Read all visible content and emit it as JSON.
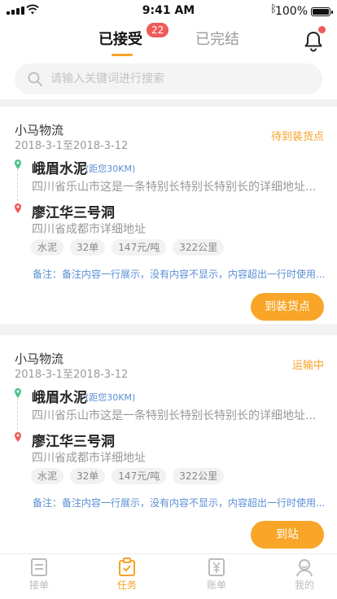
{
  "status_bar": {
    "time": "9:41 AM",
    "battery": "100%"
  },
  "header": {
    "tab_accepted": "已接受",
    "badge_count": "22",
    "tab_done": "已完结"
  },
  "search": {
    "placeholder": "请输入关键词进行搜索"
  },
  "cards": [
    {
      "company": "小马物流",
      "date": "2018-3-1至2018-3-12",
      "status": "待到装货点",
      "from_name": "峨眉水泥",
      "distance": "(距您30KM)",
      "from_addr": "四川省乐山市这是一条特别长特别长特别长的详细地址...",
      "to_name": "廖江华三号洞",
      "to_addr": "四川省成都市详细地址",
      "tags": [
        "水泥",
        "32单",
        "147元/吨",
        "322公里"
      ],
      "remark": "备注：备注内容一行展示，没有内容不显示，内容超出一行时使用...",
      "action": "到装货点"
    },
    {
      "company": "小马物流",
      "date": "2018-3-1至2018-3-12",
      "status": "运输中",
      "from_name": "峨眉水泥",
      "distance": "(距您30KM)",
      "from_addr": "四川省乐山市这是一条特别长特别长特别长的详细地址...",
      "to_name": "廖江华三号洞",
      "to_addr": "四川省成都市详细地址",
      "tags": [
        "水泥",
        "32单",
        "147元/吨",
        "322公里"
      ],
      "remark": "备注：备注内容一行展示，没有内容不显示，内容超出一行时使用...",
      "action": "到站"
    }
  ],
  "tabbar": [
    {
      "label": "接单",
      "icon": "clipboard-icon"
    },
    {
      "label": "任务",
      "icon": "task-check-icon",
      "active": true
    },
    {
      "label": "账单",
      "icon": "yen-bill-icon"
    },
    {
      "label": "我的",
      "icon": "user-icon"
    }
  ],
  "colors": {
    "accent": "#f7a128",
    "badge": "#f05a5a",
    "link": "#5b8fd4"
  }
}
